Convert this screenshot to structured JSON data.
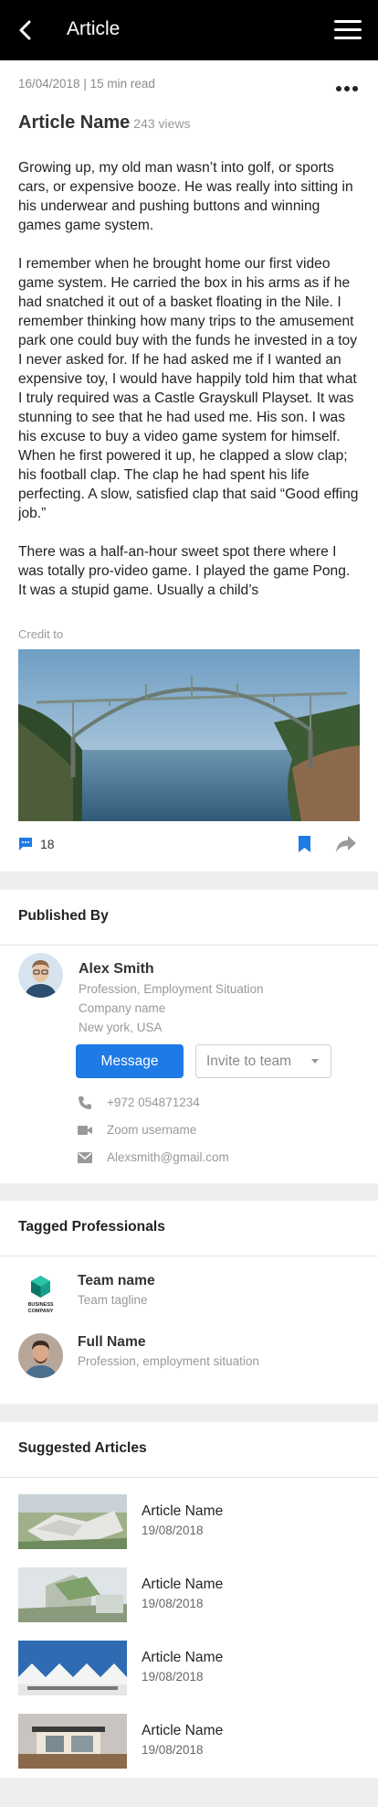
{
  "header": {
    "title": "Article",
    "back_icon": "back-arrow-icon",
    "menu_icon": "hamburger-menu-icon"
  },
  "article": {
    "meta": "16/04/2018 | 15 min read",
    "title": "Article Name",
    "views": "243 views",
    "paragraphs": [
      "Growing up, my old man wasn’t into golf, or sports cars, or expensive booze. He was really into sitting in his underwear and pushing buttons and winning games game system.",
      "I remember when he brought home our first video game system. He carried the box in his arms as if he had snatched it out of a basket floating in the Nile. I remember thinking how many trips to the amusement park one could buy with the funds he invested in a toy I never asked for. If he had asked me if I wanted an expensive toy, I would have happily told him that what I truly required was a Castle Grayskull Playset. It was stunning to see that he had used me. His son. I was his excuse to buy a video game system for himself. When he first powered it up, he clapped a slow clap; his football clap. The clap he had spent his life perfecting. A slow, satisfied clap that said “Good effing job.”",
      "There was a half-an-hour sweet spot there where I was totally pro-video game. I played the game Pong. It was a stupid game. Usually a child’s"
    ],
    "credit": "Credit to",
    "comment_count": "18",
    "colors": {
      "accent": "#1e7ae6"
    }
  },
  "published_by": {
    "section_title": "Published By",
    "name": "Alex Smith",
    "profession": "Profession, Employment Situation",
    "company": "Company name",
    "location": "New york, USA",
    "message_label": "Message",
    "invite_label": "Invite to team",
    "phone": "+972 054871234",
    "zoom": "Zoom username",
    "email": "Alexsmith@gmail.com"
  },
  "tagged": {
    "section_title": "Tagged Professionals",
    "team": {
      "name": "Team name",
      "tagline": "Team tagline",
      "logo_line1": "BUSINESS",
      "logo_line2": "COMPANY"
    },
    "person": {
      "name": "Full Name",
      "profession": "Profession, employment situation"
    }
  },
  "suggested": {
    "section_title": "Suggested Articles",
    "items": [
      {
        "title": "Article Name",
        "date": "19/08/2018"
      },
      {
        "title": "Article Name",
        "date": "19/08/2018"
      },
      {
        "title": "Article Name",
        "date": "19/08/2018"
      },
      {
        "title": "Article Name",
        "date": "19/08/2018"
      }
    ]
  }
}
